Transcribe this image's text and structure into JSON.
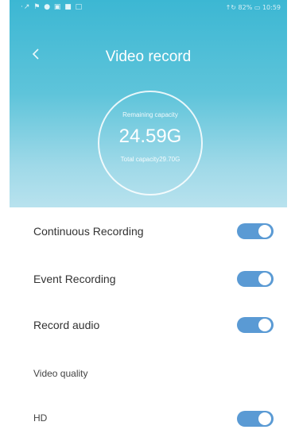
{
  "status_bar": {
    "left_icons": "·↗ ⚑ ● ▣ ■ □",
    "right_text": "↑↻ 82% ▭ 10:59"
  },
  "header": {
    "title": "Video record",
    "back_icon": "chevron-left-icon",
    "background_color": "#4fbfd8"
  },
  "capacity": {
    "remaining_label": "Remaining capacity",
    "remaining_value": "24.59G",
    "total_label": "Total capacity29.70G"
  },
  "settings": {
    "continuous_recording": {
      "label": "Continuous Recording",
      "enabled": true
    },
    "event_recording": {
      "label": "Event Recording",
      "enabled": true
    },
    "record_audio": {
      "label": "Record audio",
      "enabled": true
    },
    "video_quality_heading": "Video quality",
    "hd": {
      "label": "HD",
      "enabled": true
    }
  },
  "colors": {
    "toggle_on": "#5a9ad4",
    "text": "#333333"
  }
}
